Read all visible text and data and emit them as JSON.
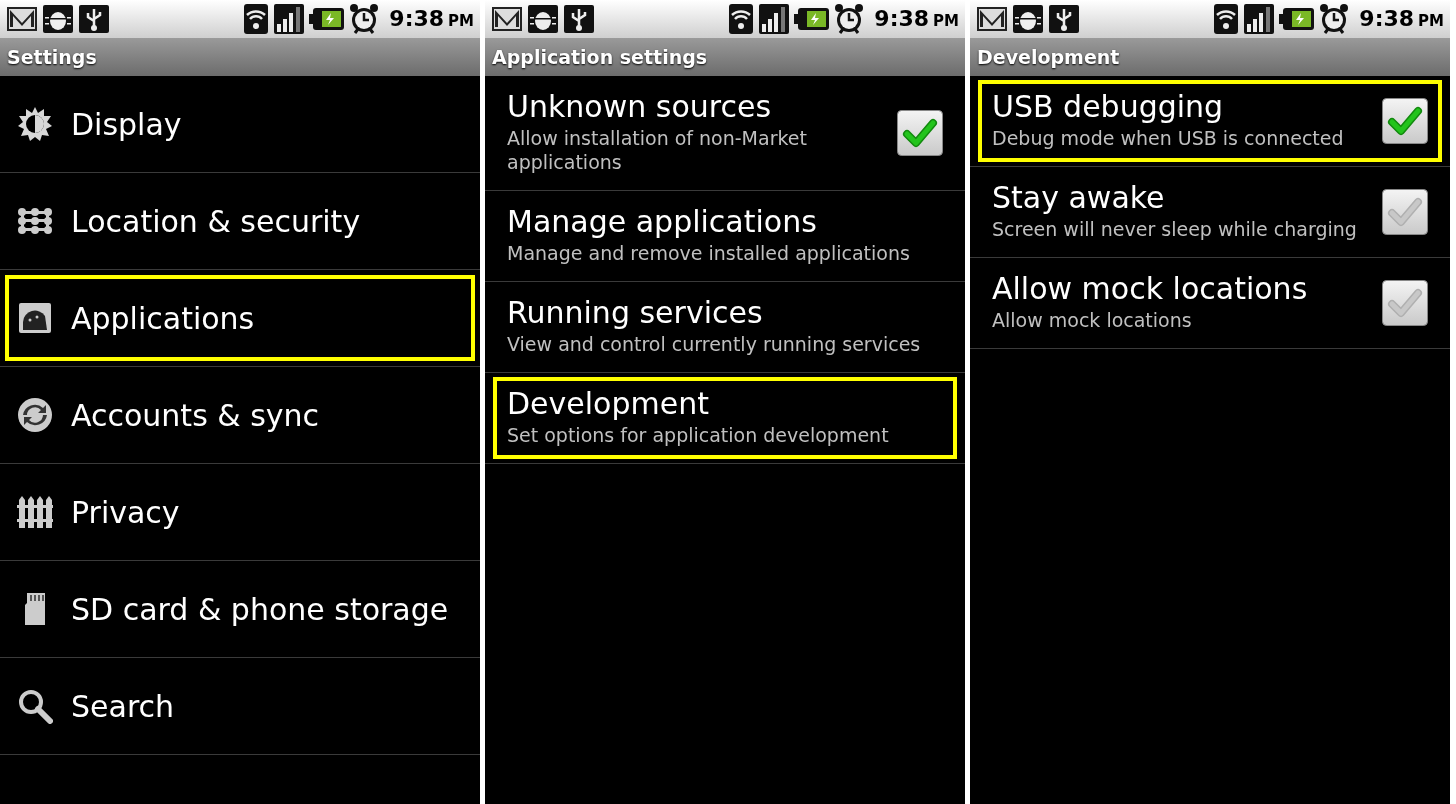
{
  "panels": [
    {
      "status_bar": {
        "time": "9:38",
        "period": "PM"
      },
      "title": "Settings",
      "items": [
        {
          "label": "Display",
          "highlighted": false
        },
        {
          "label": "Location & security",
          "highlighted": false
        },
        {
          "label": "Applications",
          "highlighted": true
        },
        {
          "label": "Accounts & sync",
          "highlighted": false
        },
        {
          "label": "Privacy",
          "highlighted": false
        },
        {
          "label": "SD card & phone storage",
          "highlighted": false
        },
        {
          "label": "Search",
          "highlighted": false
        }
      ]
    },
    {
      "status_bar": {
        "time": "9:38",
        "period": "PM"
      },
      "title": "Application settings",
      "items": [
        {
          "kind": "checkbox",
          "label": "Unknown sources",
          "summary": "Allow installation of non-Market applications",
          "checked": true,
          "highlighted": false
        },
        {
          "kind": "plain",
          "label": "Manage applications",
          "summary": "Manage and remove installed applications",
          "highlighted": false
        },
        {
          "kind": "plain",
          "label": "Running services",
          "summary": "View and control currently running services",
          "highlighted": false
        },
        {
          "kind": "plain",
          "label": "Development",
          "summary": "Set options for application development",
          "highlighted": true
        }
      ]
    },
    {
      "status_bar": {
        "time": "9:38",
        "period": "PM"
      },
      "title": "Development",
      "items": [
        {
          "kind": "checkbox",
          "label": "USB debugging",
          "summary": "Debug mode when USB is connected",
          "checked": true,
          "highlighted": true
        },
        {
          "kind": "checkbox",
          "label": "Stay awake",
          "summary": "Screen will never sleep while charging",
          "checked": false,
          "highlighted": false
        },
        {
          "kind": "checkbox",
          "label": "Allow mock locations",
          "summary": "Allow mock locations",
          "checked": false,
          "highlighted": false
        }
      ]
    }
  ]
}
